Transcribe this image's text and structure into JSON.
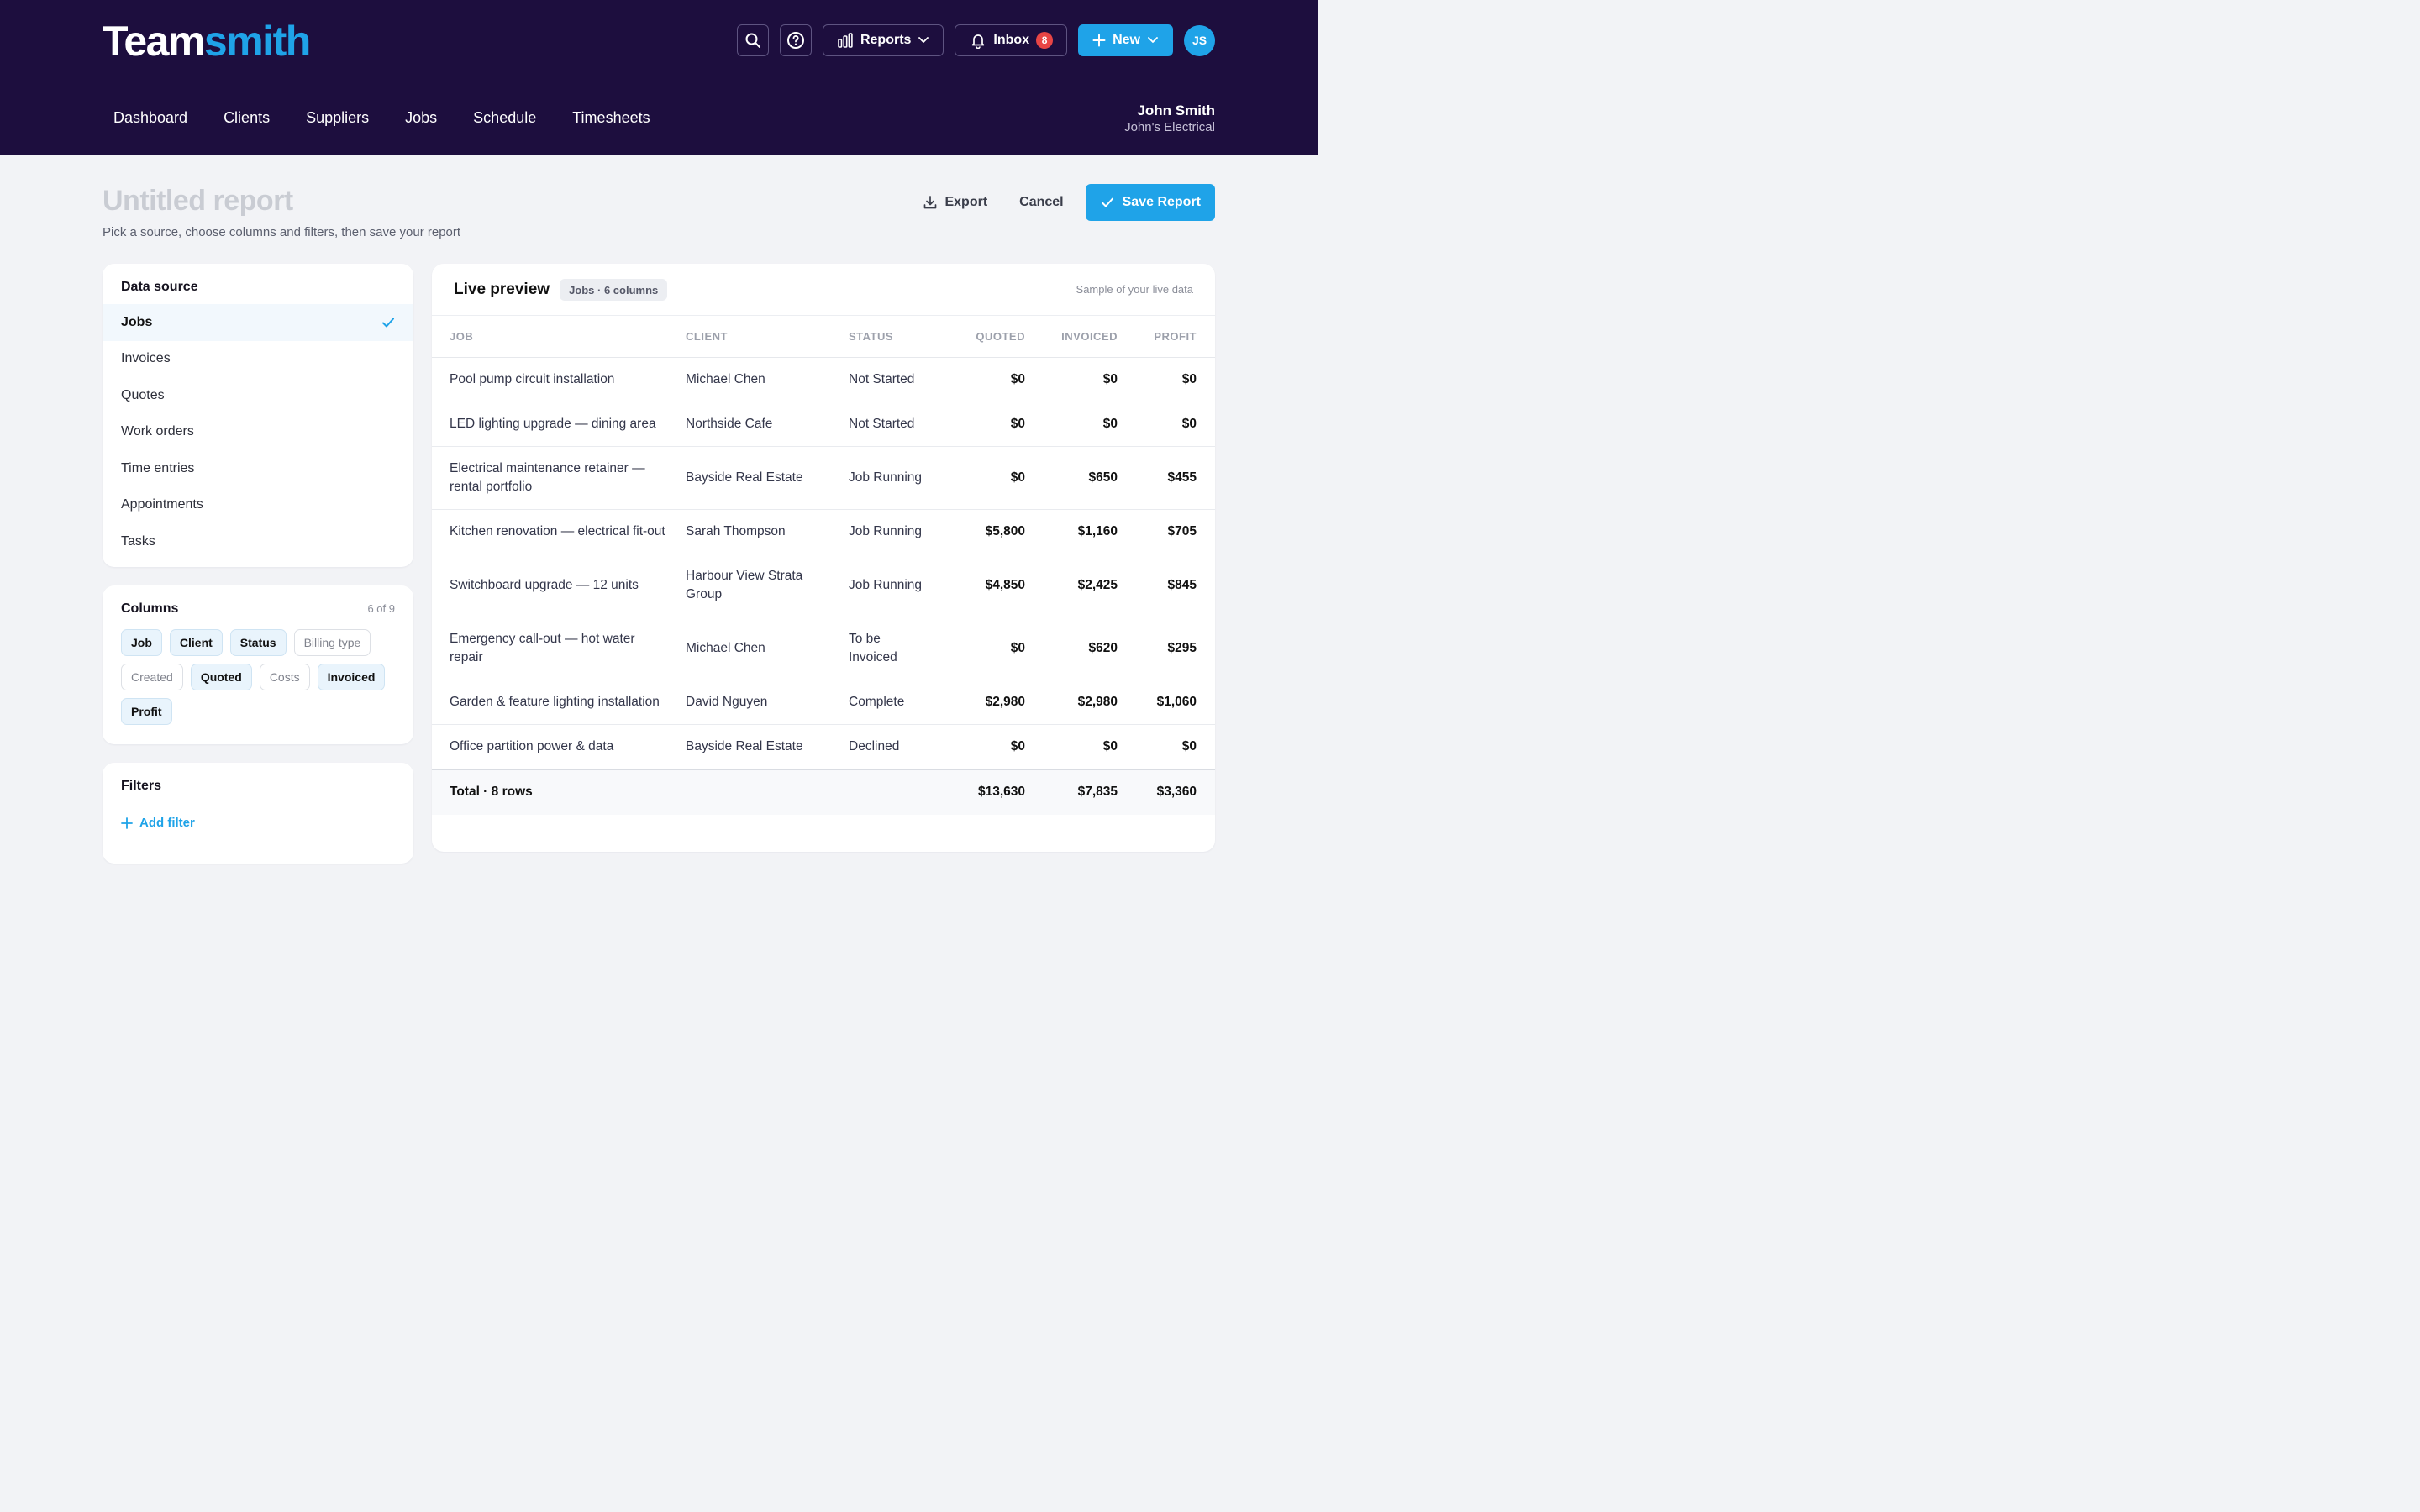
{
  "app": {
    "logo_part1": "Team",
    "logo_part2": "smith",
    "brand_color": "#1fa3e8",
    "header_bg": "#1d0e3e"
  },
  "topbar": {
    "search_icon": "search-icon",
    "help_icon": "help-circle-icon",
    "reports_label": "Reports",
    "inbox_label": "Inbox",
    "inbox_count": "8",
    "new_label": "New",
    "avatar_initials": "JS"
  },
  "nav": {
    "items": [
      "Dashboard",
      "Clients",
      "Suppliers",
      "Jobs",
      "Schedule",
      "Timesheets"
    ]
  },
  "user": {
    "name": "John Smith",
    "company": "John's Electrical"
  },
  "page": {
    "title": "Untitled report",
    "subtitle": "Pick a source, choose columns and filters, then save your report",
    "export_label": "Export",
    "cancel_label": "Cancel",
    "save_label": "Save Report"
  },
  "data_source": {
    "title": "Data source",
    "items": [
      "Jobs",
      "Invoices",
      "Quotes",
      "Work orders",
      "Time entries",
      "Appointments",
      "Tasks"
    ],
    "selected": "Jobs"
  },
  "columns": {
    "title": "Columns",
    "count": "6 of 9",
    "chips": [
      {
        "label": "Job",
        "on": true
      },
      {
        "label": "Client",
        "on": true
      },
      {
        "label": "Status",
        "on": true
      },
      {
        "label": "Billing type",
        "on": false
      },
      {
        "label": "Created",
        "on": false
      },
      {
        "label": "Quoted",
        "on": true
      },
      {
        "label": "Costs",
        "on": false
      },
      {
        "label": "Invoiced",
        "on": true
      },
      {
        "label": "Profit",
        "on": true
      }
    ]
  },
  "filters": {
    "title": "Filters",
    "add_label": "Add filter"
  },
  "preview": {
    "title": "Live preview",
    "badge": "Jobs · 6 columns",
    "note": "Sample of your live data",
    "headers": [
      "JOB",
      "CLIENT",
      "STATUS",
      "QUOTED",
      "INVOICED",
      "PROFIT"
    ],
    "rows": [
      [
        "Pool pump circuit installation",
        "Michael Chen",
        "Not Started",
        "$0",
        "$0",
        "$0"
      ],
      [
        "LED lighting upgrade — dining area",
        "Northside Cafe",
        "Not Started",
        "$0",
        "$0",
        "$0"
      ],
      [
        "Electrical maintenance retainer — rental portfolio",
        "Bayside Real Estate",
        "Job Running",
        "$0",
        "$650",
        "$455"
      ],
      [
        "Kitchen renovation — electrical fit-out",
        "Sarah Thompson",
        "Job Running",
        "$5,800",
        "$1,160",
        "$705"
      ],
      [
        "Switchboard upgrade — 12 units",
        "Harbour View Strata Group",
        "Job Running",
        "$4,850",
        "$2,425",
        "$845"
      ],
      [
        "Emergency call-out — hot water repair",
        "Michael Chen",
        "To be Invoiced",
        "$0",
        "$620",
        "$295"
      ],
      [
        "Garden & feature lighting installation",
        "David Nguyen",
        "Complete",
        "$2,980",
        "$2,980",
        "$1,060"
      ],
      [
        "Office partition power & data",
        "Bayside Real Estate",
        "Declined",
        "$0",
        "$0",
        "$0"
      ]
    ],
    "total_label": "Total · 8 rows",
    "totals": [
      "$13,630",
      "$7,835",
      "$3,360"
    ]
  }
}
